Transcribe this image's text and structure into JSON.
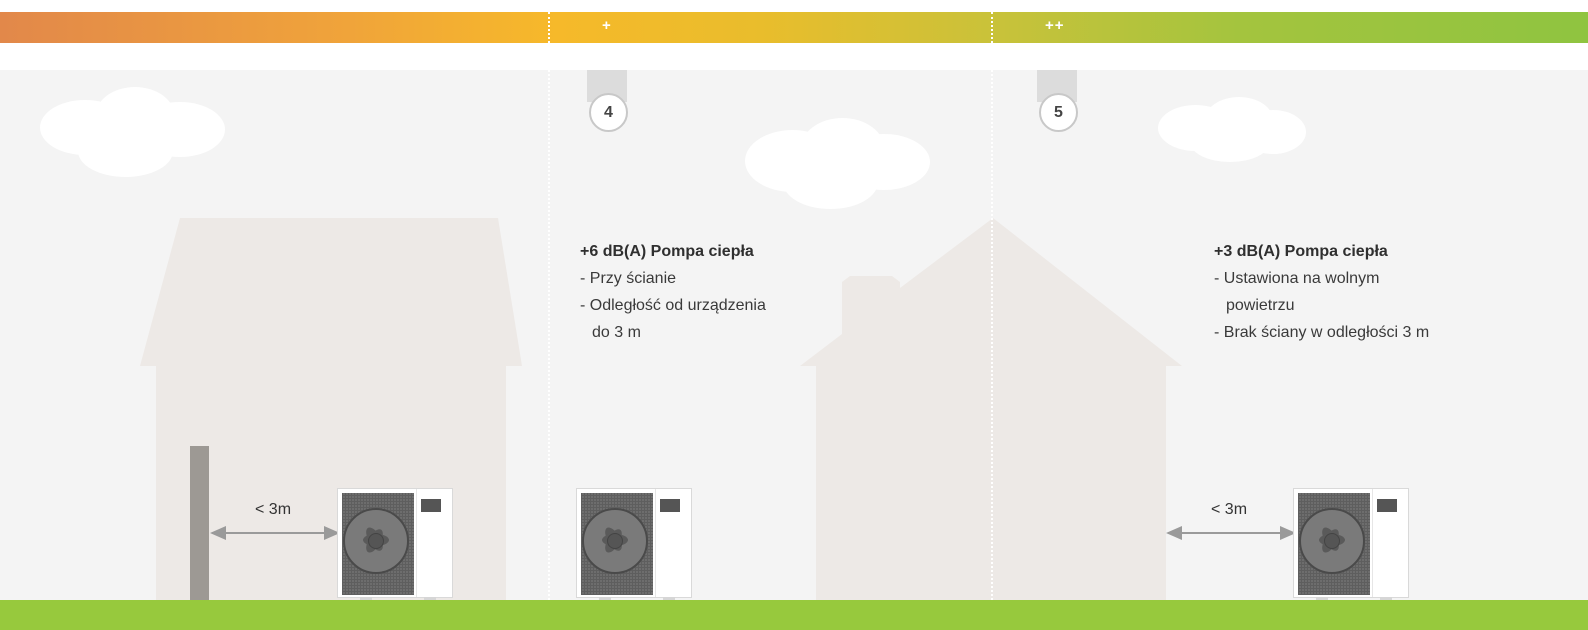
{
  "scale": {
    "levels": [
      "",
      "+",
      "++"
    ],
    "colors": {
      "start": "#e2884a",
      "middle": "#f6b92a",
      "end": "#8fc440"
    }
  },
  "panels": [
    {
      "badge": "4",
      "title": "+6 dB(A) Pompa ciepła",
      "lines": [
        "- Przy ścianie",
        "- Odległość od urządzenia",
        "do 3 m"
      ]
    },
    {
      "badge": "5",
      "title": "+3 dB(A) Pompa ciepła",
      "lines": [
        "- Ustawiona na wolnym",
        "powietrzu",
        "- Brak ściany w odległości 3 m"
      ]
    }
  ],
  "distance_labels": [
    "< 3m",
    "< 3m"
  ],
  "colors": {
    "sky": "#f4f4f4",
    "ground": "#97c93d",
    "house": "#ede9e6",
    "arrow": "#9a9a9a"
  },
  "icons": [
    "cloud-icon",
    "house-icon",
    "heat-pump-icon",
    "double-arrow-icon",
    "wall-icon"
  ]
}
